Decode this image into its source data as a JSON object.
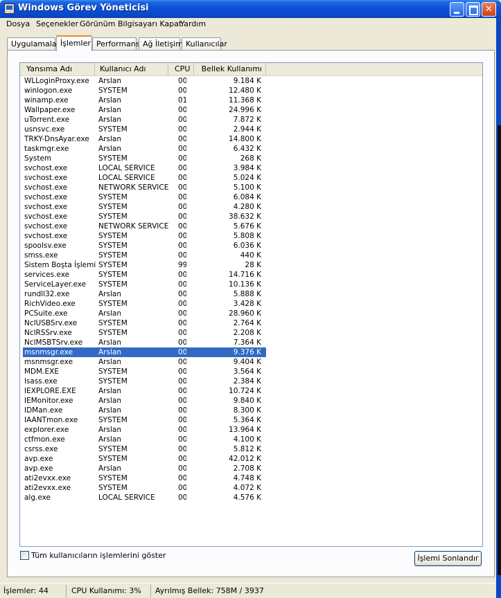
{
  "window": {
    "title": "Windows Görev Yöneticisi"
  },
  "menu": [
    "Dosya",
    "Seçenekler",
    "Görünüm",
    "Bilgisayarı Kapat",
    "Yardım"
  ],
  "tabs": [
    "Uygulamalar",
    "İşlemler",
    "Performans",
    "Ağ İletişimi",
    "Kullanıcılar"
  ],
  "active_tab": "İşlemler",
  "columns": {
    "name": "Yansıma Adı",
    "user": "Kullanıcı Adı",
    "cpu": "CPU",
    "mem": "Bellek Kullanımı"
  },
  "processes": [
    {
      "name": "WLLoginProxy.exe",
      "user": "Arslan",
      "cpu": "00",
      "mem": "9.184 K"
    },
    {
      "name": "winlogon.exe",
      "user": "SYSTEM",
      "cpu": "00",
      "mem": "12.480 K"
    },
    {
      "name": "winamp.exe",
      "user": "Arslan",
      "cpu": "01",
      "mem": "11.368 K"
    },
    {
      "name": "Wallpaper.exe",
      "user": "Arslan",
      "cpu": "00",
      "mem": "24.996 K"
    },
    {
      "name": "uTorrent.exe",
      "user": "Arslan",
      "cpu": "00",
      "mem": "7.872 K"
    },
    {
      "name": "usnsvc.exe",
      "user": "SYSTEM",
      "cpu": "00",
      "mem": "2.944 K"
    },
    {
      "name": "TRKY-DnsAyar.exe",
      "user": "Arslan",
      "cpu": "00",
      "mem": "14.800 K"
    },
    {
      "name": "taskmgr.exe",
      "user": "Arslan",
      "cpu": "00",
      "mem": "6.432 K"
    },
    {
      "name": "System",
      "user": "SYSTEM",
      "cpu": "00",
      "mem": "268 K"
    },
    {
      "name": "svchost.exe",
      "user": "LOCAL SERVICE",
      "cpu": "00",
      "mem": "3.984 K"
    },
    {
      "name": "svchost.exe",
      "user": "LOCAL SERVICE",
      "cpu": "00",
      "mem": "5.024 K"
    },
    {
      "name": "svchost.exe",
      "user": "NETWORK SERVICE",
      "cpu": "00",
      "mem": "5.100 K"
    },
    {
      "name": "svchost.exe",
      "user": "SYSTEM",
      "cpu": "00",
      "mem": "6.084 K"
    },
    {
      "name": "svchost.exe",
      "user": "SYSTEM",
      "cpu": "00",
      "mem": "4.280 K"
    },
    {
      "name": "svchost.exe",
      "user": "SYSTEM",
      "cpu": "00",
      "mem": "38.632 K"
    },
    {
      "name": "svchost.exe",
      "user": "NETWORK SERVICE",
      "cpu": "00",
      "mem": "5.676 K"
    },
    {
      "name": "svchost.exe",
      "user": "SYSTEM",
      "cpu": "00",
      "mem": "5.808 K"
    },
    {
      "name": "spoolsv.exe",
      "user": "SYSTEM",
      "cpu": "00",
      "mem": "6.036 K"
    },
    {
      "name": "smss.exe",
      "user": "SYSTEM",
      "cpu": "00",
      "mem": "440 K"
    },
    {
      "name": "Sistem Boşta İşlemi",
      "user": "SYSTEM",
      "cpu": "99",
      "mem": "28 K"
    },
    {
      "name": "services.exe",
      "user": "SYSTEM",
      "cpu": "00",
      "mem": "14.716 K"
    },
    {
      "name": "ServiceLayer.exe",
      "user": "SYSTEM",
      "cpu": "00",
      "mem": "10.136 K"
    },
    {
      "name": "rundll32.exe",
      "user": "Arslan",
      "cpu": "00",
      "mem": "5.888 K"
    },
    {
      "name": "RichVideo.exe",
      "user": "SYSTEM",
      "cpu": "00",
      "mem": "3.428 K"
    },
    {
      "name": "PCSuite.exe",
      "user": "Arslan",
      "cpu": "00",
      "mem": "28.960 K"
    },
    {
      "name": "NclUSBSrv.exe",
      "user": "SYSTEM",
      "cpu": "00",
      "mem": "2.764 K"
    },
    {
      "name": "NclRSSrv.exe",
      "user": "SYSTEM",
      "cpu": "00",
      "mem": "2.208 K"
    },
    {
      "name": "NclMSBTSrv.exe",
      "user": "Arslan",
      "cpu": "00",
      "mem": "7.364 K"
    },
    {
      "name": "msnmsgr.exe",
      "user": "Arslan",
      "cpu": "00",
      "mem": "9.376 K",
      "selected": true
    },
    {
      "name": "msnmsgr.exe",
      "user": "Arslan",
      "cpu": "00",
      "mem": "9.404 K"
    },
    {
      "name": "MDM.EXE",
      "user": "SYSTEM",
      "cpu": "00",
      "mem": "3.564 K"
    },
    {
      "name": "lsass.exe",
      "user": "SYSTEM",
      "cpu": "00",
      "mem": "2.384 K"
    },
    {
      "name": "IEXPLORE.EXE",
      "user": "Arslan",
      "cpu": "00",
      "mem": "10.724 K"
    },
    {
      "name": "IEMonitor.exe",
      "user": "Arslan",
      "cpu": "00",
      "mem": "9.840 K"
    },
    {
      "name": "IDMan.exe",
      "user": "Arslan",
      "cpu": "00",
      "mem": "8.300 K"
    },
    {
      "name": "IAANTmon.exe",
      "user": "SYSTEM",
      "cpu": "00",
      "mem": "5.364 K"
    },
    {
      "name": "explorer.exe",
      "user": "Arslan",
      "cpu": "00",
      "mem": "13.964 K"
    },
    {
      "name": "ctfmon.exe",
      "user": "Arslan",
      "cpu": "00",
      "mem": "4.100 K"
    },
    {
      "name": "csrss.exe",
      "user": "SYSTEM",
      "cpu": "00",
      "mem": "5.812 K"
    },
    {
      "name": "avp.exe",
      "user": "SYSTEM",
      "cpu": "00",
      "mem": "42.012 K"
    },
    {
      "name": "avp.exe",
      "user": "Arslan",
      "cpu": "00",
      "mem": "2.708 K"
    },
    {
      "name": "ati2evxx.exe",
      "user": "SYSTEM",
      "cpu": "00",
      "mem": "4.748 K"
    },
    {
      "name": "ati2evxx.exe",
      "user": "SYSTEM",
      "cpu": "00",
      "mem": "4.072 K"
    },
    {
      "name": "alg.exe",
      "user": "LOCAL SERVICE",
      "cpu": "00",
      "mem": "4.576 K"
    }
  ],
  "show_all_users": {
    "label": "Tüm kullanıcıların işlemlerini göster",
    "checked": false
  },
  "end_process_button": "İşlemi Sonlandır",
  "status": {
    "processes": "İşlemler: 44",
    "cpu": "CPU Kullanımı: 3%",
    "commit": "Ayrılmış Bellek: 758M / 3937"
  },
  "colors": {
    "title_blue": "#0a4fd4",
    "selection": "#316ac5",
    "window_bg": "#ece9d8"
  },
  "icons": [
    "taskmanager-icon",
    "minimize-icon",
    "maximize-icon",
    "close-icon"
  ]
}
